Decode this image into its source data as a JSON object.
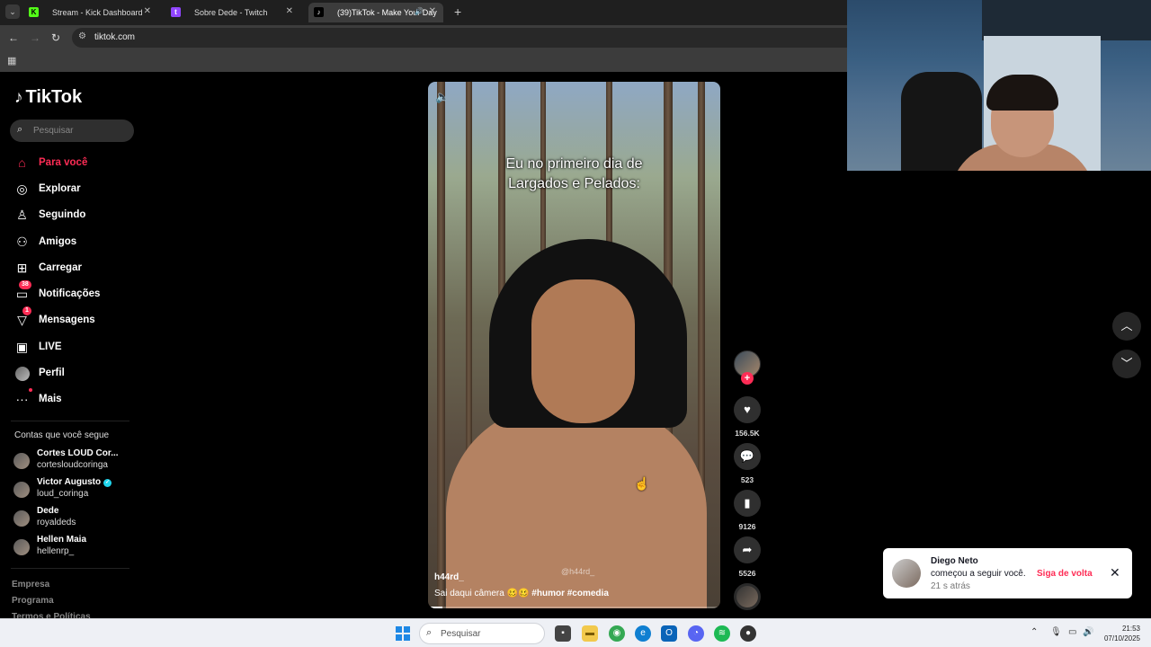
{
  "browser": {
    "tabs": [
      {
        "label": "Stream - Kick Dashboard",
        "favicon": "kick-icon",
        "color": "#53fc18"
      },
      {
        "label": "Sobre Dede - Twitch",
        "favicon": "twitch-icon",
        "color": "#9146ff"
      },
      {
        "label": "(39)TikTok - Make Your Day",
        "favicon": "tiktok-icon",
        "color": "#000000",
        "active": true
      }
    ],
    "url": "tiktok.com"
  },
  "tiktok": {
    "logo_text": "TikTok",
    "search_placeholder": "Pesquisar",
    "nav": [
      {
        "label": "Para você",
        "icon": "home-icon",
        "active": true
      },
      {
        "label": "Explorar",
        "icon": "compass-icon"
      },
      {
        "label": "Seguindo",
        "icon": "person-follow-icon"
      },
      {
        "label": "Amigos",
        "icon": "friends-icon"
      },
      {
        "label": "Carregar",
        "icon": "upload-icon"
      },
      {
        "label": "Notificações",
        "icon": "inbox-icon",
        "badge": "38"
      },
      {
        "label": "Mensagens",
        "icon": "messages-icon",
        "badge": "1"
      },
      {
        "label": "LIVE",
        "icon": "live-icon"
      },
      {
        "label": "Perfil",
        "icon": "profile-avatar"
      },
      {
        "label": "Mais",
        "icon": "more-icon"
      }
    ],
    "following_title": "Contas que você segue",
    "following": [
      {
        "name": "Cortes LOUD Cor...",
        "handle": "cortesloudcoringa"
      },
      {
        "name": "Victor Augusto",
        "handle": "loud_coringa",
        "verified": true
      },
      {
        "name": "Dede",
        "handle": "royaldeds"
      },
      {
        "name": "Hellen Maia",
        "handle": "hellenrp_"
      }
    ],
    "footer": [
      "Empresa",
      "Programa",
      "Termos e Políticas"
    ]
  },
  "video": {
    "caption_line1": "Eu no primeiro dia de",
    "caption_line2": "Largados e Pelados:",
    "author": "h44rd_",
    "description": "Sai daqui câmera 🥴🥴",
    "tags": [
      "#humor",
      "#comedia"
    ],
    "watermark": "@h44rd_",
    "progress": 0.05
  },
  "actions": {
    "likes": "156.5K",
    "comments": "523",
    "saves": "9126",
    "shares": "5526"
  },
  "notification": {
    "name": "Diego Neto",
    "message": "começou a seguir você.",
    "time": "21 s atrás",
    "action": "Siga de volta"
  },
  "taskbar": {
    "search_placeholder": "Pesquisar",
    "time": "21:53",
    "date": "07/10/2025"
  }
}
